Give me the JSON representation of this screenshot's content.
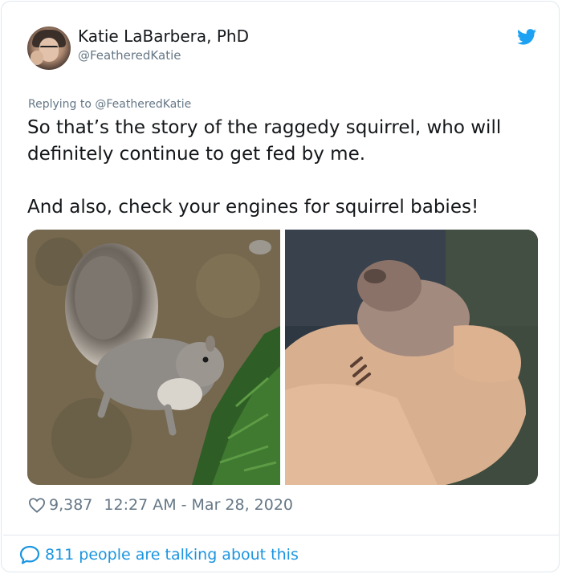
{
  "author": {
    "name": "Katie LaBarbera, PhD",
    "handle": "@FeatheredKatie"
  },
  "reply": {
    "text": "Replying to @FeatheredKatie"
  },
  "tweet": {
    "line1": "So that’s the story of the raggedy squirrel, who will definitely continue to get fed by me.",
    "line2": "And also, check your engines for squirrel babies!"
  },
  "icons": {
    "brand": "twitter-bird-icon",
    "like": "heart-icon",
    "conversation": "speech-bubble-icon"
  },
  "colors": {
    "brand": "#1da1f2",
    "link": "#1b95e0",
    "muted": "#657786",
    "text": "#14171a",
    "border": "#e1e8ed"
  },
  "meta": {
    "likes": "9,387",
    "timestamp": "12:27 AM - Mar 28, 2020"
  },
  "conversation": {
    "text": "811 people are talking about this"
  }
}
